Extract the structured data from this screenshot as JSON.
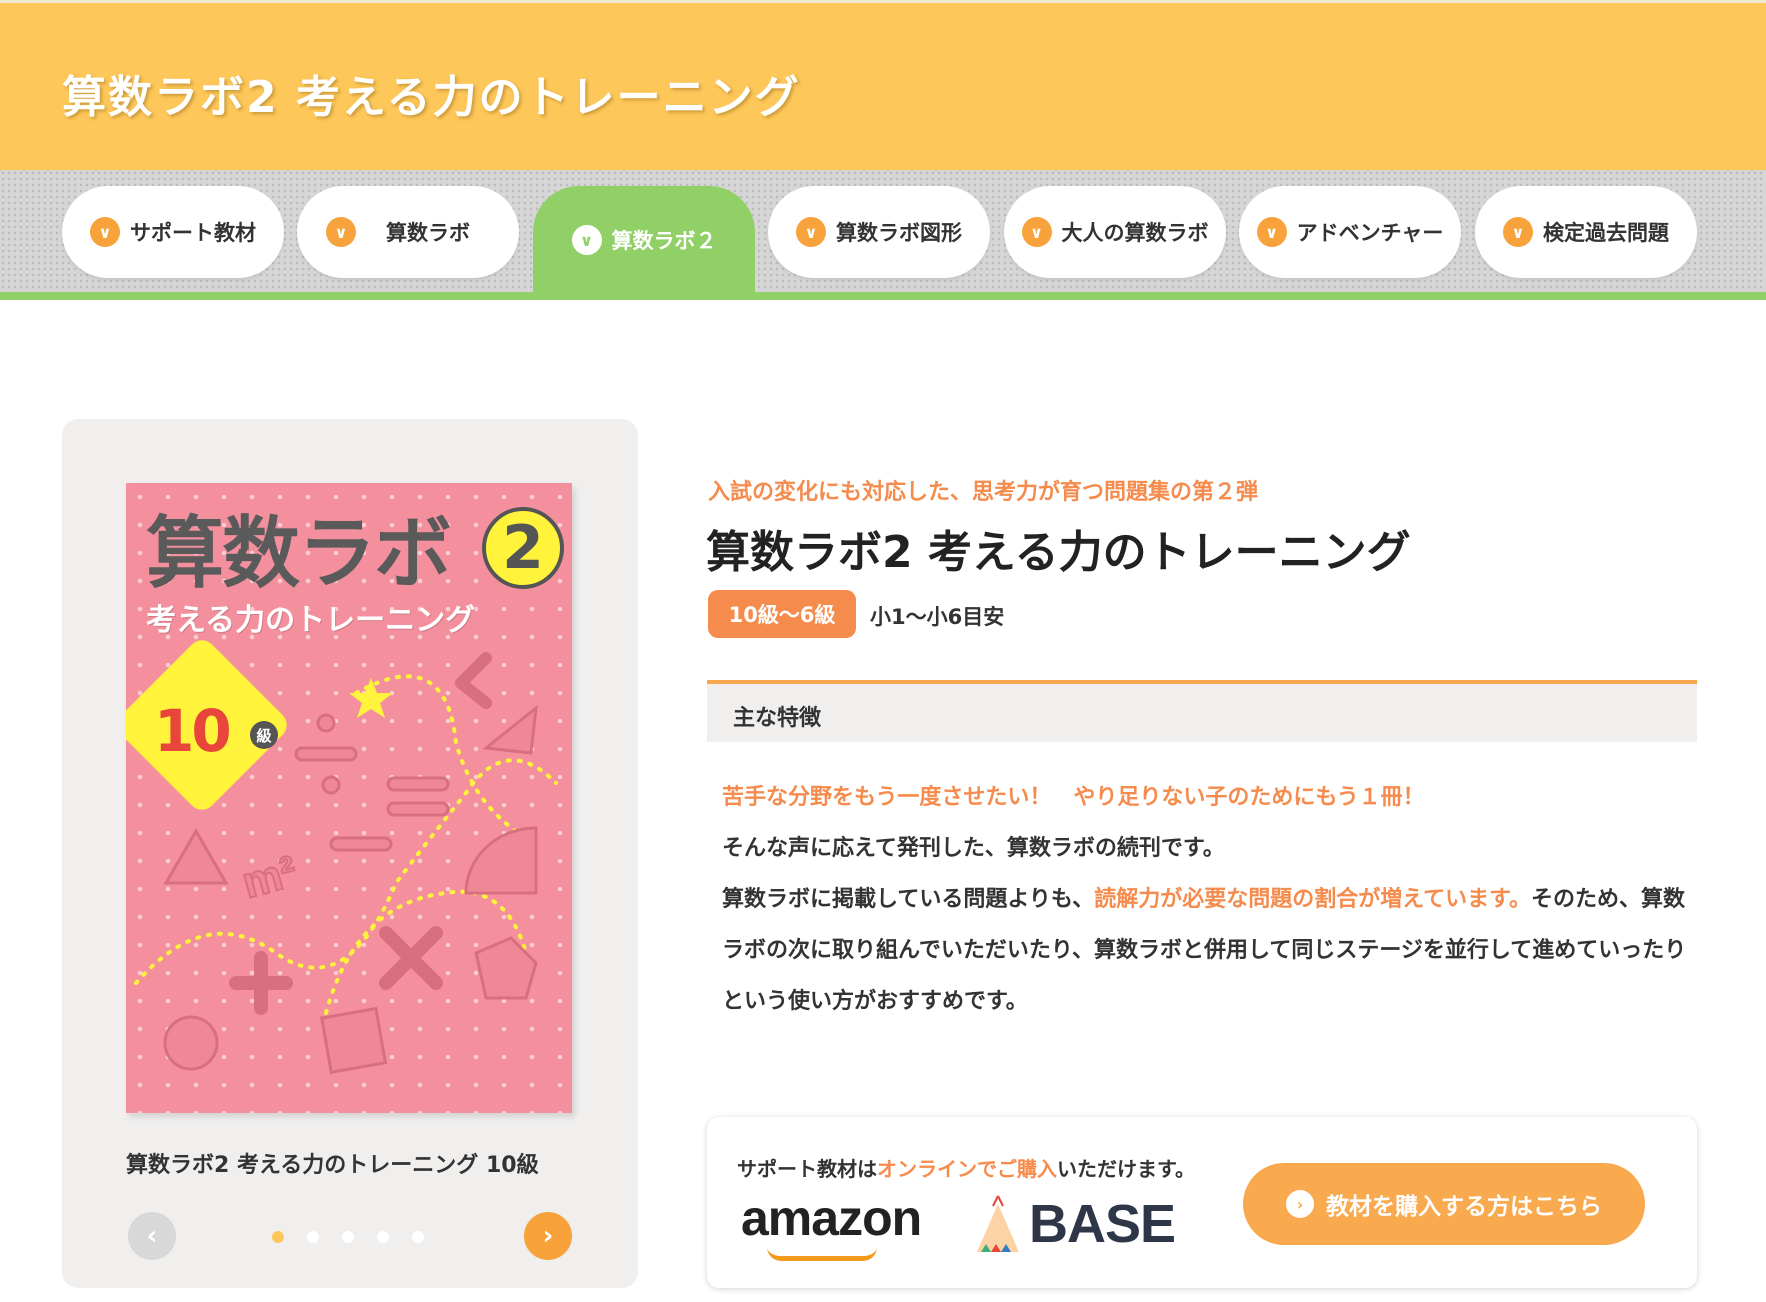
{
  "header": {
    "title": "算数ラボ2 考える力のトレーニング"
  },
  "nav": {
    "tabs": [
      {
        "label": "サポート教材",
        "active": false
      },
      {
        "label": "算数ラボ",
        "active": false
      },
      {
        "label": "算数ラボ２",
        "active": true
      },
      {
        "label": "算数ラボ図形",
        "active": false
      },
      {
        "label": "大人の算数ラボ",
        "active": false
      },
      {
        "label": "アドベンチャー",
        "active": false
      },
      {
        "label": "検定過去問題",
        "active": false
      }
    ]
  },
  "gallery": {
    "cover": {
      "title": "算数ラボ",
      "number": "2",
      "subtitle": "考える力のトレーニング",
      "grade": "10",
      "grade_unit": "級"
    },
    "caption": "算数ラボ2 考える力のトレーニング 10級",
    "prev_icon": "chevron-left-icon",
    "next_icon": "chevron-right-icon",
    "slide_count": 5,
    "current_slide": 1
  },
  "product": {
    "catch": "入試の変化にも対応した、思考力が育つ問題集の第２弾",
    "title": "算数ラボ2 考える力のトレーニング",
    "grade_badge": "10級〜6級",
    "grade_note": "小1〜小6目安",
    "features_label": "主な特徴",
    "body": {
      "line1": "苦手な分野をもう一度させたい！　やり足りない子のためにもう１冊！",
      "line2": "そんな声に応えて発刊した、算数ラボの続刊です。",
      "line3a": "算数ラボに掲載している問題よりも、",
      "line3hl": "読解力が必要な問題の割合が増えています。",
      "line3b": "そのため、算数ラボの次に取り組んでいただいたり、算数ラボと併用して同じステージを並行して進めていったりという使い方がおすすめです。"
    }
  },
  "purchase": {
    "text_a": "サポート教材は",
    "text_hl": "オンラインでご購入",
    "text_b": "いただけます。",
    "amazon_label": "amazon",
    "base_label": "BASE",
    "button_label": "教材を購入する方はこちら"
  },
  "colors": {
    "header_bg": "#fec759",
    "accent_orange": "#f58b4c",
    "nav_active": "#91d067",
    "cover_pink": "#f4909e"
  }
}
